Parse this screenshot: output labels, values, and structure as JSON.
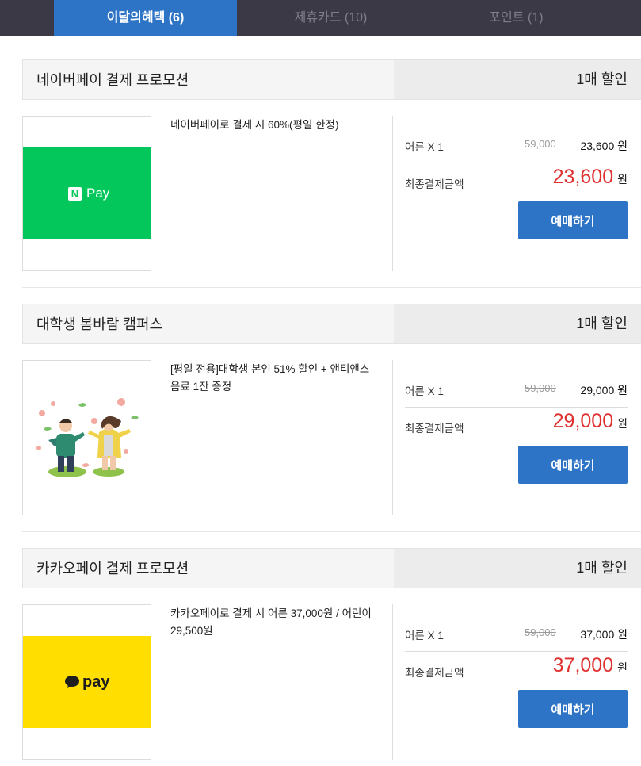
{
  "tabs": [
    {
      "label": "이달의혜택 (6)",
      "active": true
    },
    {
      "label": "제휴카드 (10)",
      "active": false
    },
    {
      "label": "포인트 (1)",
      "active": false
    }
  ],
  "promotions": [
    {
      "title": "네이버페이 결제 프로모션",
      "discount": "1매 할인",
      "image": "naver-pay-logo",
      "logo_text": "Pay",
      "logo_mark": "N",
      "description": "네이버페이로 결제 시 60%(평일 한정)",
      "adult_label": "어른 X 1",
      "original_price": "59,000",
      "sale_price": "23,600 원",
      "final_label": "최종결제금액",
      "final_amount": "23,600",
      "final_unit": "원",
      "button": "예매하기"
    },
    {
      "title": "대학생 봄바람 캠퍼스",
      "discount": "1매 할인",
      "image": "students-illustration",
      "description": "[평일 전용]대학생 본인 51% 할인 + 앤티앤스 음료 1잔 증정",
      "adult_label": "어른 X 1",
      "original_price": "59,000",
      "sale_price": "29,000 원",
      "final_label": "최종결제금액",
      "final_amount": "29,000",
      "final_unit": "원",
      "button": "예매하기"
    },
    {
      "title": "카카오페이 결제 프로모션",
      "discount": "1매 할인",
      "image": "kakao-pay-logo",
      "logo_text": "pay",
      "description": "카카오페이로 결제 시 어른 37,000원 / 어린이 29,500원",
      "adult_label": "어른 X 1",
      "original_price": "59,000",
      "sale_price": "37,000 원",
      "final_label": "최종결제금액",
      "final_amount": "37,000",
      "final_unit": "원",
      "button": "예매하기"
    }
  ],
  "colors": {
    "tabbar_bg": "#3a3945",
    "accent": "#2d74c6",
    "price_red": "#e03131",
    "naver_green": "#03c75a",
    "kakao_yellow": "#ffde00"
  }
}
